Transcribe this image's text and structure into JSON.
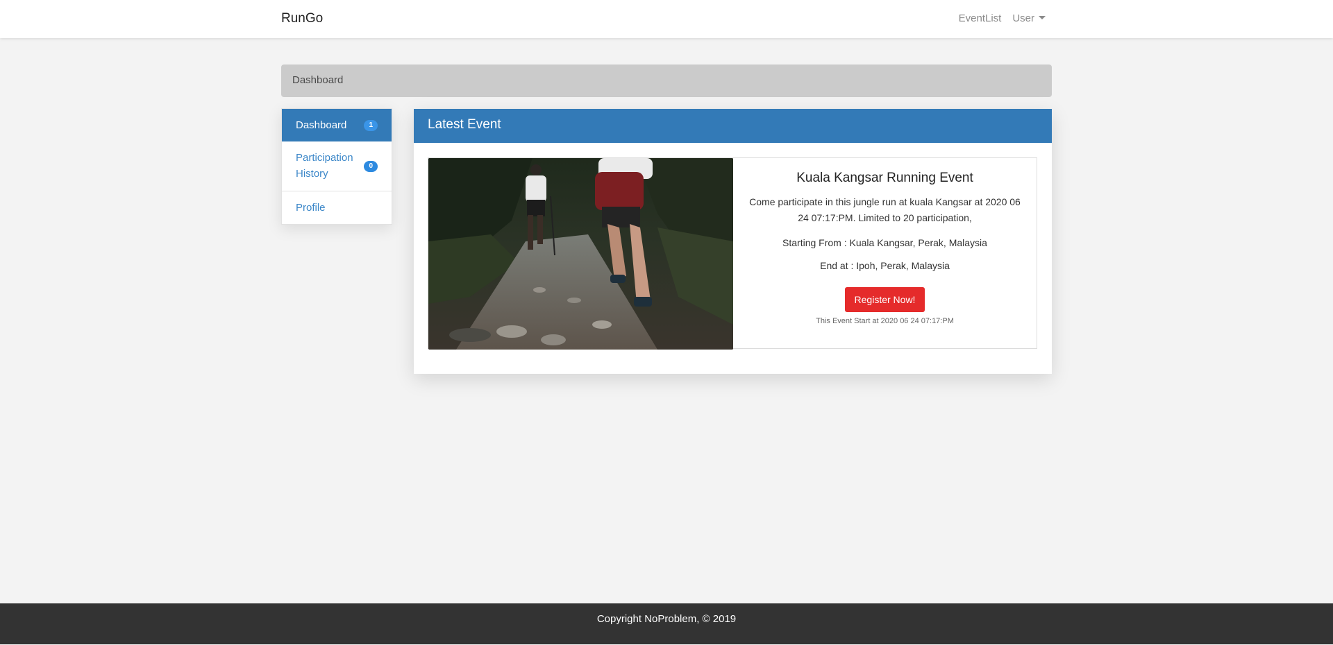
{
  "navbar": {
    "brand": "RunGo",
    "links": {
      "event_list": "EventList",
      "user": "User"
    }
  },
  "breadcrumb": {
    "label": "Dashboard"
  },
  "sidebar": {
    "items": [
      {
        "label": "Dashboard",
        "badge": "1",
        "active": true
      },
      {
        "label": "Participation History",
        "badge": "0",
        "active": false
      },
      {
        "label": "Profile",
        "badge": null,
        "active": false
      }
    ]
  },
  "panel": {
    "title": "Latest Event"
  },
  "event": {
    "title": "Kuala Kangsar Running Event",
    "description": "Come participate in this jungle run at kuala Kangsar at 2020 06 24 07:17:PM. Limited to 20 participation,",
    "starting_from": "Starting From : Kuala Kangsar, Perak, Malaysia",
    "end_at": "End at : Ipoh, Perak, Malaysia",
    "register_label": "Register Now!",
    "start_note": "This Event Start at 2020 06 24 07:17:PM"
  },
  "footer": {
    "text": "Copyright NoProblem, © 2019"
  },
  "colors": {
    "primary": "#337ab7",
    "danger": "#e52b2b",
    "footer": "#333333",
    "background": "#f3f3f3",
    "breadcrumb": "#cbcbcb"
  }
}
